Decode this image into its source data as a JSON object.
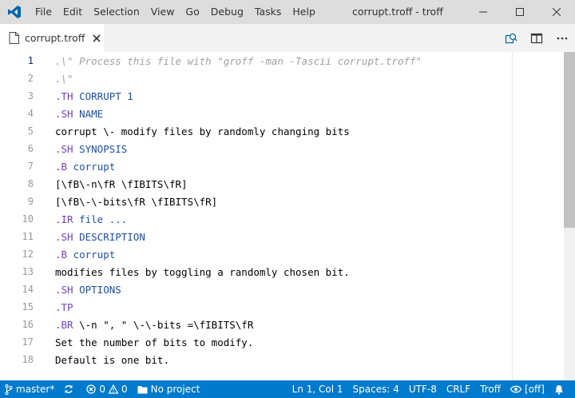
{
  "window": {
    "title": "corrupt.troff - troff"
  },
  "menu": [
    "File",
    "Edit",
    "Selection",
    "View",
    "Go",
    "Debug",
    "Tasks",
    "Help"
  ],
  "tab": {
    "label": "corrupt.troff"
  },
  "editor": {
    "active_line": 1,
    "lines": [
      {
        "n": "1",
        "tokens": [
          {
            "t": "comment",
            "v": ".\\\" Process this file with \"groff -man -Tascii corrupt.troff\""
          }
        ]
      },
      {
        "n": "2",
        "tokens": [
          {
            "t": "comment",
            "v": ".\\\""
          }
        ]
      },
      {
        "n": "3",
        "tokens": [
          {
            "t": "macro",
            "v": ".TH"
          },
          {
            "t": "arg",
            "v": " CORRUPT 1"
          }
        ]
      },
      {
        "n": "4",
        "tokens": [
          {
            "t": "macro",
            "v": ".SH"
          },
          {
            "t": "arg",
            "v": " NAME"
          }
        ]
      },
      {
        "n": "5",
        "tokens": [
          {
            "t": "text",
            "v": "corrupt \\- modify files by randomly changing bits"
          }
        ]
      },
      {
        "n": "6",
        "tokens": [
          {
            "t": "macro",
            "v": ".SH"
          },
          {
            "t": "arg",
            "v": " SYNOPSIS"
          }
        ]
      },
      {
        "n": "7",
        "tokens": [
          {
            "t": "macro",
            "v": ".B"
          },
          {
            "t": "arg",
            "v": " corrupt"
          }
        ]
      },
      {
        "n": "8",
        "tokens": [
          {
            "t": "text",
            "v": "[\\fB\\-n\\fR \\fIBITS\\fR]"
          }
        ]
      },
      {
        "n": "9",
        "tokens": [
          {
            "t": "text",
            "v": "[\\fB\\-\\-bits\\fR \\fIBITS\\fR]"
          }
        ]
      },
      {
        "n": "10",
        "tokens": [
          {
            "t": "macro",
            "v": ".IR"
          },
          {
            "t": "arg",
            "v": " file ..."
          }
        ]
      },
      {
        "n": "11",
        "tokens": [
          {
            "t": "macro",
            "v": ".SH"
          },
          {
            "t": "arg",
            "v": " DESCRIPTION"
          }
        ]
      },
      {
        "n": "12",
        "tokens": [
          {
            "t": "macro",
            "v": ".B"
          },
          {
            "t": "arg",
            "v": " corrupt"
          }
        ]
      },
      {
        "n": "13",
        "tokens": [
          {
            "t": "text",
            "v": "modifies files by toggling a randomly chosen bit."
          }
        ]
      },
      {
        "n": "14",
        "tokens": [
          {
            "t": "macro",
            "v": ".SH"
          },
          {
            "t": "arg",
            "v": " OPTIONS"
          }
        ]
      },
      {
        "n": "15",
        "tokens": [
          {
            "t": "macro",
            "v": ".TP"
          }
        ]
      },
      {
        "n": "16",
        "tokens": [
          {
            "t": "macro",
            "v": ".BR"
          },
          {
            "t": "text",
            "v": " \\-n \", \" \\-\\-bits =\\fIBITS\\fR"
          }
        ]
      },
      {
        "n": "17",
        "tokens": [
          {
            "t": "text",
            "v": "Set the number of bits to modify."
          }
        ]
      },
      {
        "n": "18",
        "tokens": [
          {
            "t": "text",
            "v": "Default is one bit."
          }
        ]
      }
    ]
  },
  "status": {
    "branch": "master*",
    "errors": "0",
    "warnings": "0",
    "project": "No project",
    "position": "Ln 1, Col 1",
    "spaces": "Spaces: 4",
    "encoding": "UTF-8",
    "eol": "CRLF",
    "language": "Troff",
    "eye": "[off]"
  },
  "colors": {
    "status_bar": "#007acc",
    "title_bar": "#dddddd",
    "vscode_blue": "#0065a9"
  },
  "icons": [
    "vscode-logo-icon",
    "troff-file-icon",
    "close-icon",
    "open-changes-icon",
    "split-editor-icon",
    "more-actions-icon",
    "git-branch-icon",
    "sync-icon",
    "error-icon",
    "warning-icon",
    "folder-icon",
    "eye-icon",
    "bell-icon"
  ]
}
